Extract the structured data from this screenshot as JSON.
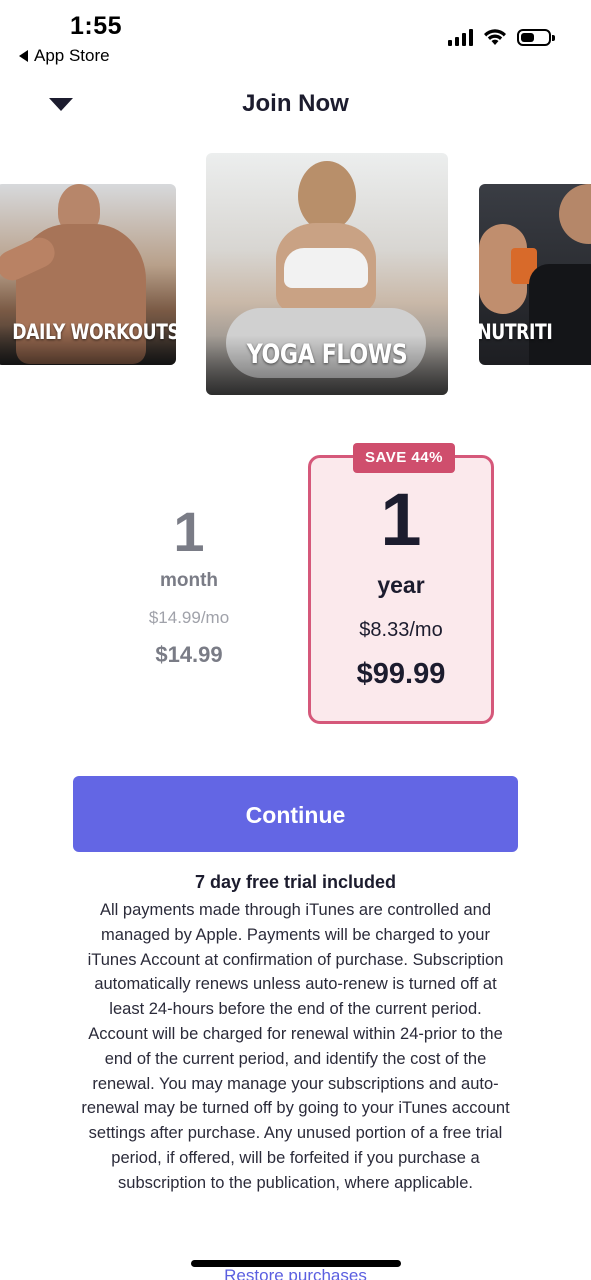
{
  "status_bar": {
    "time": "1:55",
    "back_app": "App Store",
    "icons": [
      "cellular-signal-icon",
      "wifi-icon",
      "battery-icon"
    ],
    "battery_level": 0.5
  },
  "header": {
    "title": "Join Now",
    "collapse_icon": "chevron-down-icon"
  },
  "carousel": {
    "items": [
      {
        "label": "DAILY WORKOUTS"
      },
      {
        "label": "YOGA FLOWS"
      },
      {
        "label": "NUTRITI"
      }
    ]
  },
  "plans": {
    "month": {
      "quantity": "1",
      "unit": "month",
      "per_month": "$14.99/mo",
      "total": "$14.99"
    },
    "year": {
      "badge": "SAVE 44%",
      "quantity": "1",
      "unit": "year",
      "per_month": "$8.33/mo",
      "total": "$99.99",
      "selected": true
    }
  },
  "cta": {
    "continue_label": "Continue"
  },
  "legal": {
    "trial_title": "7 day free trial included",
    "body": "All payments made through iTunes are controlled and managed by Apple. Payments will be charged to your iTunes Account at confirmation of purchase. Subscription automatically renews unless auto-renew is turned off at least 24-hours before the end of the current period. Account will be charged for renewal within 24-prior to the end of the current period, and identify the cost of the renewal. You may manage your subscriptions and auto-renewal may be turned off by going to your iTunes account settings after purchase. Any unused portion of a free trial period, if offered, will be forfeited if you purchase a subscription to the publication, where applicable."
  },
  "footer": {
    "restore_label": "Restore purchases"
  },
  "colors": {
    "accent": "#6366e4",
    "badge": "#cf4e6d",
    "selected_border": "#d5587a",
    "selected_bg": "#fbe9ec"
  }
}
